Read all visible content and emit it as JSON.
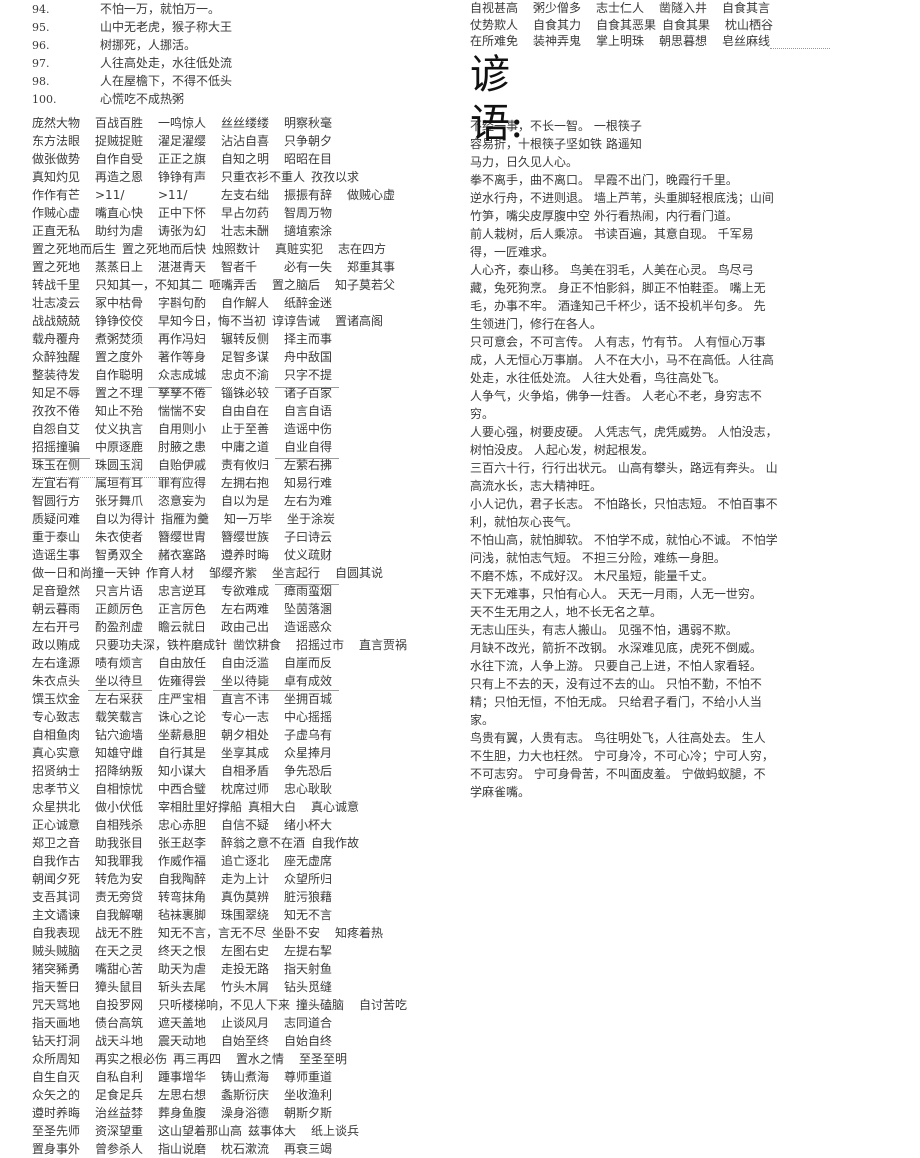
{
  "numbered": [
    {
      "n": "94.",
      "text": "不怕一万，就怕万一。"
    },
    {
      "n": "95.",
      "text": "山中无老虎，猴子称大王"
    },
    {
      "n": "96.",
      "text": "树挪死，人挪活。"
    },
    {
      "n": "97.",
      "text": "人往高处走，水往低处流"
    },
    {
      "n": "98.",
      "text": "人在屋檐下，不得不低头"
    },
    {
      "n": "100.",
      "text": "心慌吃不成热粥"
    }
  ],
  "idiom_rows": [
    [
      "庞然大物",
      "百战百胜",
      "一鸣惊人",
      "丝丝缕缕",
      "明察秋毫"
    ],
    [
      "东方法眼",
      "捉贼捉赃",
      "濯足濯缨",
      "沾沾自喜",
      "只争朝夕"
    ],
    [
      "做张做势",
      "自作自受",
      "正正之旗",
      "自知之明",
      "昭昭在目"
    ],
    [
      "真知灼见",
      "再造之恩",
      "铮铮有声",
      "只重衣衫不重人",
      "孜孜以求"
    ],
    [
      "作作有芒",
      ">11/",
      ">11/",
      "左支右绌",
      "振振有辞",
      "做贼心虚"
    ],
    [
      "作贼心虚",
      "嘴直心快",
      "正中下怀",
      "早占勿药",
      "智周万物"
    ],
    [
      "正直无私",
      "助纣为虐",
      "诪张为幻",
      "壮志未酬",
      "擿埴索涂"
    ],
    [
      "置之死地而后生",
      "置之死地而后快",
      "烛照数计",
      "真赃实犯",
      "志在四方"
    ],
    [
      "置之死地",
      "蒸蒸日上",
      "湛湛青天",
      "智者千",
      "必有一失",
      "郑重其事"
    ],
    [
      "转战千里",
      "只知其一，不知其二",
      "咂嘴弄舌",
      "置之脑后",
      "知子莫若父"
    ],
    [
      "壮志凌云",
      "冢中枯骨",
      "字斟句酌",
      "自作解人",
      "纸醉金迷"
    ],
    [
      "战战兢兢",
      "铮铮佼佼",
      "早知今日，悔不当初",
      "谆谆告诫",
      "置诸高阁"
    ],
    [
      "载舟覆舟",
      "煮粥焚须",
      "再作冯妇",
      "辗转反侧",
      "择主而事"
    ],
    [
      "众醉独醒",
      "置之度外",
      "著作等身",
      "足智多谋",
      "舟中敌国"
    ],
    [
      "整装待发",
      "自作聪明",
      "众志成城",
      "忠贞不渝",
      "只字不提"
    ],
    [
      "知足不辱",
      "置之不理",
      "孳孳不倦",
      "锱铢必较",
      "诸子百家"
    ],
    [
      "孜孜不倦",
      "知止不殆",
      "惴惴不安",
      "自由自在",
      "自言自语"
    ],
    [
      "自怨自艾",
      "仗义执言",
      "自用则小",
      "止于至善",
      "造谣中伤"
    ],
    [
      "招摇撞骗",
      "中原逐鹿",
      "肘腋之患",
      "中庸之道",
      "自业自得"
    ],
    [
      "珠玉在侧",
      "珠圆玉润",
      "自贻伊戚",
      "责有攸归",
      "左萦右拂"
    ],
    [
      "左宜右有",
      "属垣有耳",
      "罪有应得",
      "左拥右抱",
      "知易行难"
    ],
    [
      "智圆行方",
      "张牙舞爪",
      "恣意妄为",
      "自以为是",
      "左右为难"
    ],
    [
      "质疑问难",
      "自以为得计",
      "指雁为羹",
      "知一万毕",
      "坐于涂炭"
    ],
    [
      "重于泰山",
      "朱衣使者",
      "簪缨世胄",
      "簪缨世族",
      "子曰诗云"
    ],
    [
      "造谣生事",
      "智勇双全",
      "赭衣塞路",
      "遵养时晦",
      "仗义疏财"
    ],
    [
      "做一日和尚撞一天钟",
      "作育人材",
      "邹缨齐紫",
      "坐言起行",
      "自圆其说"
    ],
    [
      "足音跫然",
      "只言片语",
      "忠言逆耳",
      "专欲难成",
      "瘴雨蛮烟"
    ],
    [
      "朝云暮雨",
      "正颜厉色",
      "正言厉色",
      "左右两难",
      "坠茵落溷"
    ],
    [
      "左右开弓",
      "酌盈剂虚",
      "瞻云就日",
      "政由己出",
      "造谣惑众"
    ],
    [
      "政以贿成",
      "只要功夫深，铁杵磨成针",
      "凿饮耕食",
      "招摇过市",
      "直言贾祸"
    ],
    [
      "左右逢源",
      "啧有烦言",
      "自由放任",
      "自由泛滥",
      "自崖而反"
    ],
    [
      "朱衣点头",
      "坐以待旦",
      "佐雍得尝",
      "坐以待毙",
      "卓有成效"
    ],
    [
      "馔玉炊金",
      "左右采获",
      "庄严宝相",
      "直言不讳",
      "坐拥百城"
    ],
    [
      "专心致志",
      "载笑载言",
      "诛心之论",
      "专心一志",
      "中心摇摇"
    ],
    [
      "自相鱼肉",
      "钻穴逾墙",
      "坐薪悬胆",
      "朝夕相处",
      "子虚乌有"
    ],
    [
      "真心实意",
      "知雄守雌",
      "自行其是",
      "坐享其成",
      "众星捧月"
    ],
    [
      "招贤纳士",
      "招降纳叛",
      "知小谋大",
      "自相矛盾",
      "争先恐后"
    ],
    [
      "忠孝节义",
      "自相惊忧",
      "中西合璧",
      "枕席过师",
      "忠心耿耿"
    ],
    [
      "众星拱北",
      "做小伏低",
      "宰相肚里好撑船",
      "真相大白",
      "真心诚意"
    ],
    [
      "正心诚意",
      "自相残杀",
      "忠心赤胆",
      "自信不疑",
      "绪小杯大"
    ],
    [
      "郑卫之音",
      "助我张目",
      "张王赵李",
      "醉翁之意不在酒",
      "自我作故"
    ],
    [
      "自我作古",
      "知我罪我",
      "作威作福",
      "追亡逐北",
      "座无虚席"
    ],
    [
      "朝闻夕死",
      "转危为安",
      "自我陶醉",
      "走为上计",
      "众望所归"
    ],
    [
      "支吾其词",
      "责无旁贷",
      "转弯抹角",
      "真伪莫辨",
      "脏污狼藉"
    ],
    [
      "主文谲谏",
      "自我解嘲",
      "毡袜裹脚",
      "珠围翠绕",
      "知无不言"
    ],
    [
      "自我表现",
      "战无不胜",
      "知无不言，言无不尽",
      "坐卧不安",
      "知疼着热"
    ],
    [
      "贼头贼脑",
      "在天之灵",
      "终天之恨",
      "左图右史",
      "左提右挈"
    ],
    [
      "猪突豨勇",
      "嘴甜心苦",
      "助天为虐",
      "走投无路",
      "指天射鱼"
    ],
    [
      "指天誓日",
      "獐头鼠目",
      "斩头去尾",
      "竹头木屑",
      "钻头觅缝"
    ],
    [
      "咒天骂地",
      "自投罗网",
      "只听楼梯响，不见人下来",
      "撞头磕脑",
      "自讨苦吃"
    ],
    [
      "指天画地",
      "债台高筑",
      "遮天盖地",
      "止谈风月",
      "志同道合"
    ],
    [
      "钻天打洞",
      "战天斗地",
      "震天动地",
      "自始至终",
      "自始自终"
    ],
    [
      "众所周知",
      "再实之根必伤",
      "再三再四",
      "置水之情",
      "至圣至明"
    ],
    [
      "自生自灭",
      "自私自利",
      "踵事增华",
      "铸山煮海",
      "尊师重道"
    ],
    [
      "众矢之的",
      "足食足兵",
      "左思右想",
      "螽斯衍庆",
      "坐收渔利"
    ],
    [
      "遵时养晦",
      "治丝益棼",
      "葬身鱼腹",
      "澡身浴德",
      "朝斯夕斯"
    ],
    [
      "至圣先师",
      "资深望重",
      "这山望着那山高",
      "兹事体大",
      "纸上谈兵"
    ],
    [
      "置身事外",
      "曾参杀人",
      "指山说磨",
      "枕石漱流",
      "再衰三竭"
    ]
  ],
  "right_idiom_rows": [
    [
      "自视甚高",
      "粥少僧多",
      "志士仁人",
      "凿隧入井",
      "自食其言"
    ],
    [
      "仗势欺人",
      "自食其力",
      "自食其恶果",
      "自食其果",
      "枕山栖谷"
    ],
    [
      "在所难免",
      "装神弄鬼",
      "掌上明珠",
      "朝思暮想",
      "皂丝麻线"
    ]
  ],
  "heading": {
    "line1": "谚",
    "line2": "语:"
  },
  "proverb_lines": [
    "不经一事，不长一智。 一根筷子",
    "容易折，十根筷子坚如铁 路遥知",
    "马力，日久见人心。",
    "拳不离手，曲不离口。 早霞不出门，晚霞行千里。",
    "逆水行舟，不进则退。 墙上芦苇，头重脚轻根底浅；山间",
    "竹笋，嘴尖皮厚腹中空 外行看热闹，内行看门道。",
    "前人栽树，后人乘凉。 书读百遍，其意自现。 千军易",
    "得，一匠难求。",
    "人心齐，泰山移。 鸟美在羽毛，人美在心灵。 鸟尽弓",
    "藏，兔死狗烹。 身正不怕影斜，脚正不怕鞋歪。 嘴上无",
    "毛，办事不牢。 酒逢知己千杯少，话不投机半句多。 先",
    "生领进门，修行在各人。",
    "只可意会，不可言传。 人有志，竹有节。 人有恒心万事",
    "成，人无恒心万事崩。 人不在大小，马不在高低。人往高",
    "处走，水往低处流。 人往大处看，鸟往高处飞。",
    "人争气，火争焰，佛争一炷香。 人老心不老，身穷志不",
    "穷。",
    "人要心强，树要皮硬。 人凭志气，虎凭威势。 人怕没志，",
    "树怕没皮。 人起心发，树起根发。",
    "三百六十行，行行出状元。 山高有攀头，路远有奔头。 山",
    "高流水长，志大精神旺。",
    "小人记仇，君子长志。 不怕路长，只怕志短。 不怕百事不",
    "利，就怕灰心丧气。",
    "不怕山高，就怕脚软。 不怕学不成，就怕心不诚。 不怕学",
    "问浅，就怕志气短。 不担三分险，难练一身胆。",
    "不磨不炼，不成好汉。 木尺虽短，能量千丈。",
    "天下无难事，只怕有心人。 天无一月雨，人无一世穷。",
    "天不生无用之人，地不长无名之草。",
    "无志山压头，有志人搬山。 见强不怕，遇弱不欺。",
    "月缺不改光，箭折不改钢。 水深难见底，虎死不倒威。",
    "水往下流，人争上游。 只要自己上进，不怕人家看轻。",
    "只有上不去的天，没有过不去的山。 只怕不勤，不怕不",
    "精；只怕无恒，不怕无成。 只给君子看门，不给小人当",
    "家。",
    "鸟贵有翼，人贵有志。 鸟往明处飞，人往高处去。 生人",
    "不生胆，力大也枉然。 宁可身冷，不可心冷；宁可人穷，",
    "不可志穷。 宁可身骨苦，不叫面皮羞。 宁做蚂蚁腿，不",
    "学麻雀嘴。"
  ]
}
